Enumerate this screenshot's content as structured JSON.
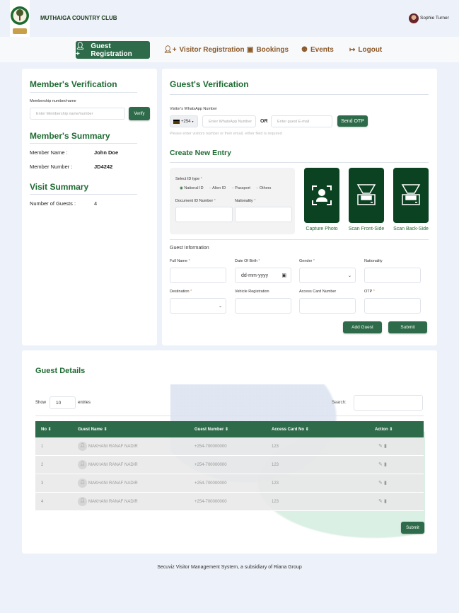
{
  "header": {
    "club_name": "MUTHAIGA COUNTRY CLUB",
    "logo_text": "Since 1913",
    "user_name": "Sophie Turner"
  },
  "nav": [
    {
      "label": "Guest Registration",
      "icon": "user-plus-icon",
      "active": true
    },
    {
      "label": "Visitor Registration",
      "icon": "user-plus-icon"
    },
    {
      "label": "Bookings",
      "icon": "address-book-icon"
    },
    {
      "label": "Events",
      "icon": "users-icon"
    },
    {
      "label": "Logout",
      "icon": "sign-out-icon"
    }
  ],
  "member_verification": {
    "title": "Member's Verification",
    "field_label": "Membership number/name",
    "placeholder": "Enter Membership name/number",
    "verify_label": "Verify"
  },
  "member_summary": {
    "title": "Member's Summary",
    "name_label": "Member Name :",
    "name_value": "John Doe",
    "number_label": "Member Number :",
    "number_value": "JD4242"
  },
  "visit_summary": {
    "title": "Visit Summary",
    "guests_label": "Number of Guests :",
    "guests_value": "4"
  },
  "guest_verification": {
    "title": "Guest's Verification",
    "whatsapp_label": "Visitor's WhatsApp Number",
    "country_code": "+254",
    "whatsapp_placeholder": "Enter WhatsApp Number",
    "or_label": "OR",
    "email_placeholder": "Enter guest E-mail",
    "send_otp_label": "Send OTP",
    "help_text": "Please enter visitors number or their email, either field is required"
  },
  "create_entry": {
    "title": "Create New Entry",
    "id_type_label": "Select ID type",
    "id_types": [
      "National ID",
      "Alien ID",
      "Passport",
      "Others"
    ],
    "selected_id_type": "National ID",
    "doc_id_label": "Document ID Number",
    "nationality_label": "Nationality",
    "tiles": [
      "Capture Photo",
      "Scan Front-Side",
      "Scan Back-Side"
    ]
  },
  "guest_info": {
    "title": "Guest Information",
    "full_name": "Full Name",
    "dob": "Date Of Birth",
    "dob_placeholder": "dd-mm-yyyy",
    "gender": "Gender",
    "nationality": "Nationality",
    "destination": "Destination",
    "vehicle": "Vehicle Registration",
    "access_card": "Access Card Number",
    "otp": "OTP",
    "add_guest_label": "Add Guest",
    "submit_label": "Submit"
  },
  "guest_details": {
    "title": "Guest Details",
    "show_label": "Show",
    "entries_value": "10",
    "entries_label": "entries",
    "search_label": "Search:",
    "columns": [
      "No",
      "Guest Name",
      "Guest Number",
      "Access Card No",
      "Action"
    ],
    "rows": [
      {
        "no": "1",
        "name": "MAKHANI RANAF NADIR",
        "number": "+254-700000000",
        "card": "123"
      },
      {
        "no": "2",
        "name": "MAKHANI RANAF NADIR",
        "number": "+254-700000000",
        "card": "123"
      },
      {
        "no": "3",
        "name": "MAKHANI RANAF NADIR",
        "number": "+254-700000000",
        "card": "123"
      },
      {
        "no": "4",
        "name": "MAKHANI RANAF NADIR",
        "number": "+254-700000000",
        "card": "123"
      }
    ],
    "submit_label": "Submit"
  },
  "footer": {
    "text": "Secuviz Visitor Management System, a subsidiary of Riana Group"
  },
  "colors": {
    "primary": "#2e6b4a",
    "heading": "#1f6b33",
    "nav_text": "#8b5a2b",
    "tile": "#0b4322"
  }
}
